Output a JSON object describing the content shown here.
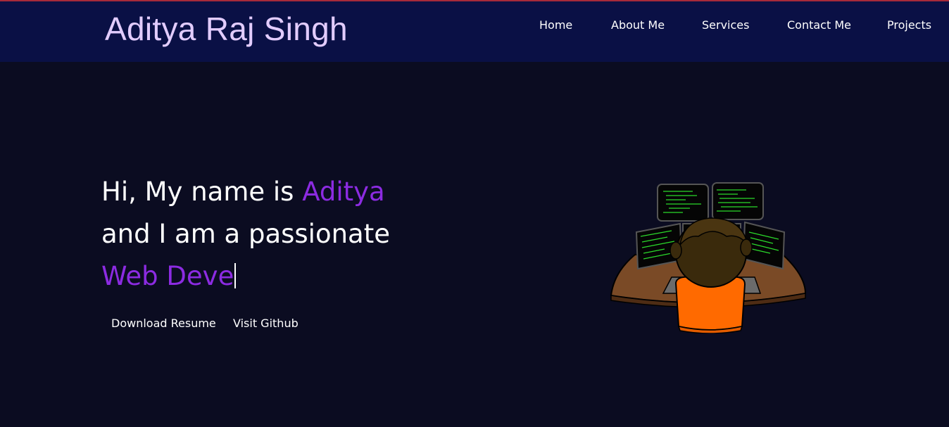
{
  "header": {
    "brand": "Aditya Raj Singh",
    "nav": [
      "Home",
      "About Me",
      "Services",
      "Contact Me",
      "Projects"
    ]
  },
  "hero": {
    "line1_prefix": "Hi, My name is ",
    "line1_name": "Aditya",
    "line2": "and I am a passionate",
    "typed_text": "Web Deve"
  },
  "buttons": {
    "download": "Download Resume",
    "github": "Visit Github"
  },
  "illustration": {
    "icon": "developer-at-monitors-icon"
  },
  "colors": {
    "background": "#0b0c21",
    "header": "#0a1045",
    "brand": "#e2ccff",
    "accent": "#8c2be2",
    "shirt": "#ff6a00",
    "desk": "#7a4a26",
    "code": "#2bd92b"
  }
}
